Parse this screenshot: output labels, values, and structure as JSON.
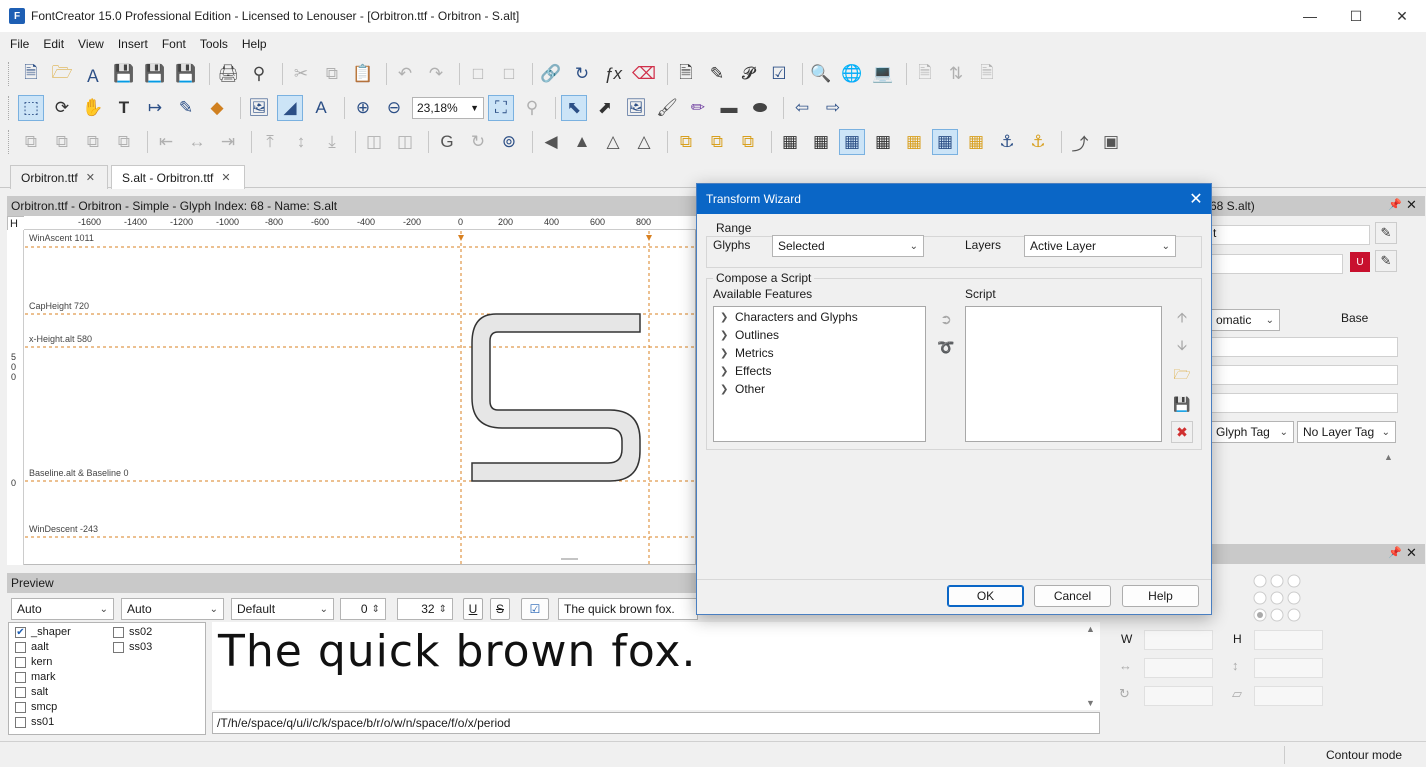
{
  "window": {
    "title": "FontCreator 15.0 Professional Edition - Licensed to Lenouser - [Orbitron.ttf - Orbitron - S.alt]",
    "app_icon": "F"
  },
  "menu": [
    "File",
    "Edit",
    "View",
    "Insert",
    "Font",
    "Tools",
    "Help"
  ],
  "toolbar": {
    "zoom_value": "23,18%"
  },
  "tabs": [
    {
      "label": "Orbitron.ttf"
    },
    {
      "label": "S.alt - Orbitron.ttf"
    }
  ],
  "glyph_editor": {
    "header": "Orbitron.ttf - Orbitron - Simple - Glyph Index: 68 - Name: S.alt",
    "ruler_x": [
      "-1600",
      "-1400",
      "-1200",
      "-1000",
      "-800",
      "-600",
      "-400",
      "-200",
      "0",
      "200",
      "400",
      "600",
      "800"
    ],
    "ruler_corner": "H",
    "ruler_y_a": "5",
    "ruler_y_b": "0",
    "ruler_y_c": "0",
    "ruler_y_d": "0",
    "guides": {
      "win_ascent": "WinAscent 1011",
      "cap_height": "CapHeight 720",
      "x_height": "x-Height.alt 580",
      "baseline": "Baseline.alt & Baseline 0",
      "win_descent": "WinDescent -243"
    }
  },
  "preview": {
    "header": "Preview",
    "combo1": "Auto",
    "combo2": "Auto",
    "combo3": "Default",
    "spin1": "0",
    "spin2": "32",
    "btn_u": "U",
    "btn_s": "S",
    "sample_text": "The quick brown fox.",
    "features": [
      {
        "label": "_shaper",
        "checked": true
      },
      {
        "label": "aalt",
        "checked": false
      },
      {
        "label": "kern",
        "checked": false
      },
      {
        "label": "mark",
        "checked": false
      },
      {
        "label": "salt",
        "checked": false
      },
      {
        "label": "smcp",
        "checked": false
      },
      {
        "label": "ss01",
        "checked": false
      },
      {
        "label": "ss02",
        "checked": false
      },
      {
        "label": "ss03",
        "checked": false
      }
    ],
    "glyph_string": "/T/h/e/space/q/u/i/c/k/space/b/r/o/w/n/space/f/o/x/period"
  },
  "right_panel": {
    "header_suffix": "68 S.alt)",
    "field_t": "t",
    "combo_auto": "omatic",
    "base_label": "Base",
    "glyph_tag": "Glyph Tag",
    "layer_tag": "No Layer Tag",
    "w_label": "W",
    "h_label": "H"
  },
  "status": {
    "mode": "Contour mode"
  },
  "dialog": {
    "title": "Transform Wizard",
    "range_label": "Range",
    "glyphs_label": "Glyphs",
    "glyphs_value": "Selected",
    "layers_label": "Layers",
    "layers_value": "Active Layer",
    "compose_label": "Compose a Script",
    "available_label": "Available Features",
    "script_label": "Script",
    "features": [
      "Characters and Glyphs",
      "Outlines",
      "Metrics",
      "Effects",
      "Other"
    ],
    "ok": "OK",
    "cancel": "Cancel",
    "help": "Help"
  }
}
